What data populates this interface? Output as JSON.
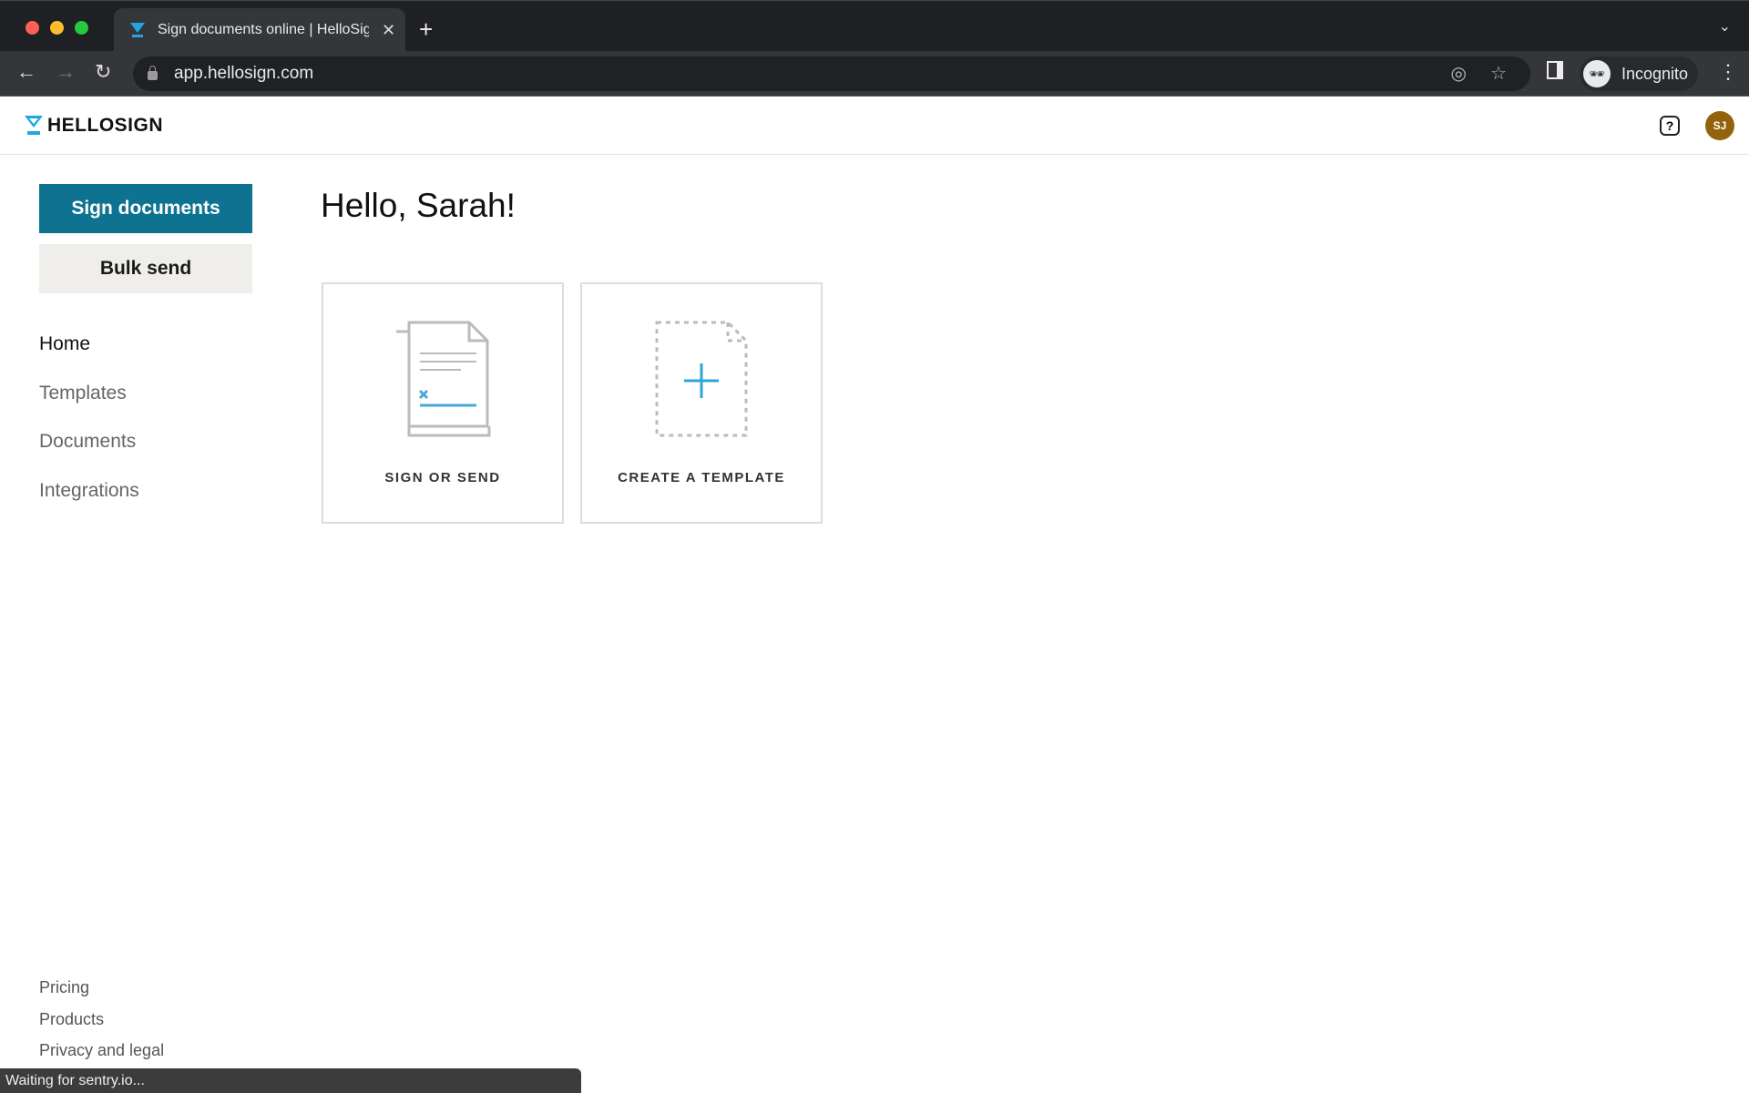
{
  "browser": {
    "tab_title": "Sign documents online | HelloSign",
    "url": "app.hellosign.com",
    "profile_label": "Incognito",
    "status_text": "Waiting for sentry.io..."
  },
  "app": {
    "logo_text": "HELLOSIGN",
    "brand_color": "#0d7391",
    "accent_color": "#1ea7e1",
    "avatar_initials": "SJ",
    "avatar_color": "#94620c"
  },
  "sidebar": {
    "primary_button": "Sign documents",
    "secondary_button": "Bulk send",
    "items": [
      {
        "label": "Home",
        "active": true
      },
      {
        "label": "Templates"
      },
      {
        "label": "Documents"
      },
      {
        "label": "Integrations"
      }
    ],
    "footer_links": [
      "Pricing",
      "Products",
      "Privacy and legal"
    ]
  },
  "main": {
    "greeting": "Hello, Sarah!",
    "cards": [
      {
        "label": "SIGN OR SEND",
        "icon": "document-sign-icon"
      },
      {
        "label": "CREATE A TEMPLATE",
        "icon": "new-template-icon"
      }
    ]
  }
}
